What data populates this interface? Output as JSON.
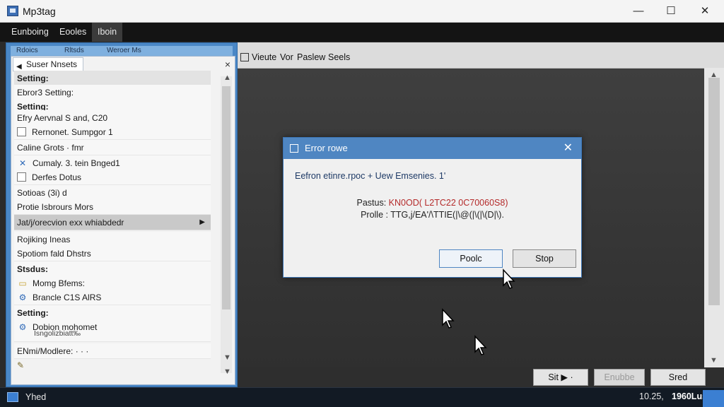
{
  "window": {
    "title": "Mp3tag",
    "controls": {
      "minimize": "—",
      "maximize": "☐",
      "close": "✕"
    }
  },
  "menubar": {
    "items": [
      {
        "label": "Eunboing"
      },
      {
        "label": "Eooles"
      },
      {
        "label": "Iboin"
      }
    ]
  },
  "sidebar": {
    "toolbar": [
      "Rdoics",
      "Rltsds",
      "Weroer Ms"
    ],
    "tab_label": "Suser Nnsets",
    "close": "×",
    "rows": [
      {
        "kind": "header",
        "label": "Setting:"
      },
      {
        "kind": "plain",
        "label": "Ebror3 Setting:"
      },
      {
        "kind": "header-lite",
        "label": "Setting:"
      },
      {
        "kind": "plain",
        "label": "Efry Aervnal S and, C20"
      },
      {
        "kind": "check",
        "label": "Rernonet. Sumpgor 1"
      },
      {
        "kind": "plain",
        "label": "Caline Grots  ·  fmr"
      },
      {
        "kind": "icon",
        "icon": "tool-icon",
        "label": "Cumaly. 3. tein Bnged1"
      },
      {
        "kind": "check",
        "label": "Derfes Dotus"
      },
      {
        "kind": "plain",
        "label": "Sotioas (3i) d"
      },
      {
        "kind": "plain",
        "label": "Protie Isbrours Mors"
      },
      {
        "kind": "selected",
        "label": "Jat/j/orecvion exx whiabdedr"
      },
      {
        "kind": "plain",
        "label": "Rojiking Ineas"
      },
      {
        "kind": "plain",
        "label": "Spotiom fald Dhstrs"
      },
      {
        "kind": "plain",
        "label": "Stsdus:"
      },
      {
        "kind": "icon",
        "icon": "folder-icon",
        "label": "Momg Bfems:"
      },
      {
        "kind": "icon",
        "icon": "gear-icon",
        "label": "Brancle C1S AlRS"
      },
      {
        "kind": "header-lite",
        "label": "Setting:"
      },
      {
        "kind": "icon-tall",
        "icon": "gear-icon",
        "label": "Dobion mohomet",
        "sublabel": "Isngolizbiatt‰"
      },
      {
        "kind": "plain",
        "label": "ENmi/Modlere:  ·  ·  ·"
      }
    ]
  },
  "main": {
    "toolbar": [
      "Vieute",
      "Vor",
      "Paslew",
      "Seels"
    ],
    "bottom_buttons": [
      {
        "label": "Sit  ▶  ·"
      },
      {
        "label": "Enubbe"
      },
      {
        "label": "Sred"
      }
    ]
  },
  "dialog": {
    "title": "Error rowe",
    "message": "Eefron etinre.rpoc + Uew Emsenies. 1'",
    "detail1_label": "Pastus:",
    "detail1_value": "KN0OD( L2TC22 0C70060S8)",
    "detail2_label": "Prolle :",
    "detail2_value": "TTG,j/EA'/\\TTIE(|\\@(|\\(|\\(D|\\).",
    "buttons": {
      "primary": "Poolc",
      "secondary": "Stop"
    }
  },
  "taskbar": {
    "label": "Yhed",
    "time": "10.25,",
    "date": "1960Lus"
  }
}
